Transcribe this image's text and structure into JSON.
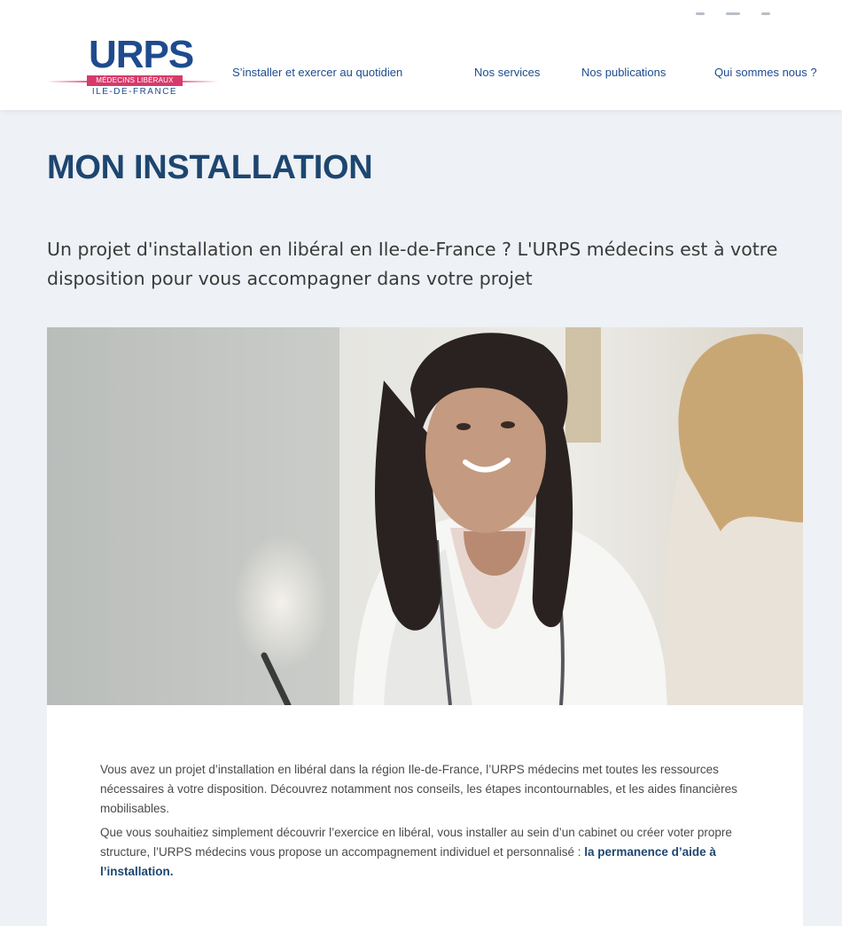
{
  "logo": {
    "name": "URPS",
    "subtitle": "MÉDECINS LIBÉRAUX",
    "region": "ILE-DE-FRANCE"
  },
  "nav": {
    "items": [
      {
        "label": "S’installer et exercer au quotidien"
      },
      {
        "label": "Nos services"
      },
      {
        "label": "Nos publications"
      },
      {
        "label": "Qui sommes nous ?"
      }
    ]
  },
  "top_icons": [
    "social-icon",
    "social-icon",
    "social-icon"
  ],
  "page": {
    "title": "MON INSTALLATION",
    "intro": "Un projet d'installation en libéral en Ile-de-France ? L'URPS médecins est à votre disposition pour vous accompagner dans votre projet"
  },
  "content": {
    "paragraph1": "Vous avez un projet d’installation en libéral dans la région Ile-de-France, l’URPS médecins met toutes les ressources nécessaires à votre disposition. Découvrez notamment nos conseils, les étapes incontournables, et les aides financières mobilisables.",
    "paragraph2": "Que vous souhaitiez simplement découvrir l’exercice en libéral, vous installer au sein d’un cabinet ou créer voter propre structure,  l’URPS médecins vous propose un accompagnement individuel et personnalisé : ",
    "link": "la permanence d’aide à l’installation."
  },
  "colors": {
    "brand_blue": "#1e4b8e",
    "title_blue": "#1d4670",
    "brand_pink": "#d63a6b",
    "page_bg": "#eef1f5"
  }
}
